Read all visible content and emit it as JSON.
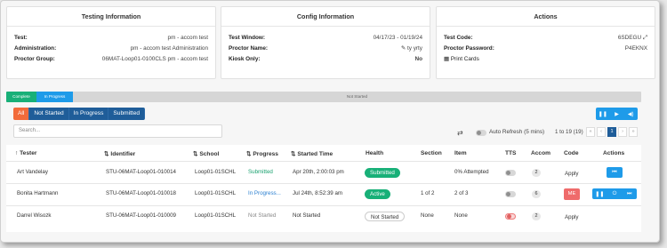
{
  "cards": {
    "testing": {
      "title": "Testing Information",
      "rows": [
        {
          "k": "Test:",
          "v": "pm - accom test"
        },
        {
          "k": "Administration:",
          "v": "pm - accom test Administration"
        },
        {
          "k": "Proctor Group:",
          "v": "06MAT-Loop01-0100CLS pm - accom test"
        }
      ]
    },
    "config": {
      "title": "Config Information",
      "rows": [
        {
          "k": "Test Window:",
          "v": "04/17/23 - 01/19/24"
        },
        {
          "k": "Proctor Name:",
          "v": "ty yrty"
        },
        {
          "k": "Kiosk Only:",
          "v": "No"
        }
      ]
    },
    "actions": {
      "title": "Actions",
      "rows": [
        {
          "k": "Test Code:",
          "v": "6SDEGU"
        },
        {
          "k": "Proctor Password:",
          "v": "P4EKNX"
        }
      ],
      "print_cards": "Print Cards"
    }
  },
  "progress_bar": {
    "complete": "Complete",
    "in_progress": "In Progress",
    "not_started": "Not Started"
  },
  "filters": [
    "All",
    "Not Started",
    "In Progress",
    "Submitted"
  ],
  "search": {
    "placeholder": "Search..."
  },
  "auto_refresh": "Auto Refresh (5 mins)",
  "pager": {
    "info": "1 to 19 (19)",
    "prev2": "«",
    "prev": "‹",
    "current": "1",
    "next": "›",
    "next2": "»"
  },
  "columns": [
    "Tester",
    "Identifier",
    "School",
    "Progress",
    "Started Time",
    "Health",
    "Section",
    "Item",
    "TTS",
    "Accom",
    "Code",
    "Actions"
  ],
  "rows": [
    {
      "tester": "Art Vandelay",
      "identifier": "STU-06MAT-Loop01-010014",
      "school": "Loop01-01SCHL",
      "progress": "Submitted",
      "started": "Apr 20th, 2:00:03 pm",
      "health": "Submitted",
      "section": "",
      "item": "0% Attempted",
      "accom": "2",
      "code": "Apply"
    },
    {
      "tester": "Bonita Hartmann",
      "identifier": "STU-06MAT-Loop01-010018",
      "school": "Loop01-01SCHL",
      "progress": "In Progress...",
      "started": "Jul 24th, 8:52:39 am",
      "health": "Active",
      "section": "1 of 2",
      "item": "2 of 3",
      "accom": "6",
      "code": "ME"
    },
    {
      "tester": "Darrel Wisozk",
      "identifier": "STU-06MAT-Loop01-010009",
      "school": "Loop01-01SCHL",
      "progress": "Not Started",
      "started": "Not Started",
      "health": "Not Started",
      "section": "None",
      "item": "None",
      "accom": "2",
      "code": "Apply"
    }
  ],
  "colors": {
    "accent": "#1e9be9",
    "navy": "#1f5d99",
    "orange": "#f26b3a",
    "green": "#18b078",
    "red": "#ef6b6b"
  }
}
